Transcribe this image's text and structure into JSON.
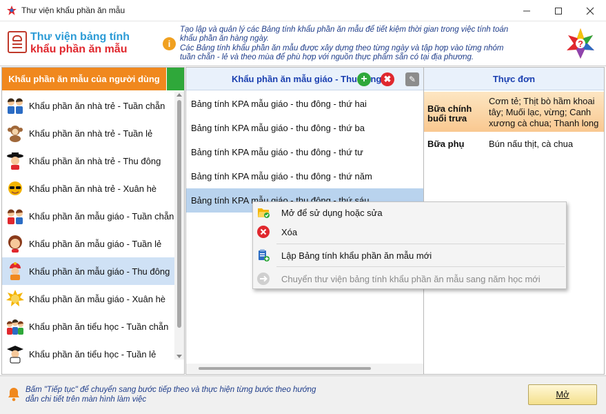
{
  "window": {
    "title": "Thư viện khẩu phần ăn mẫu"
  },
  "header": {
    "brand_line1": "Thư viện bảng tính",
    "brand_line2": "khẩu phần ăn mẫu",
    "desc_line1": "Tạo lập và quản lý các Bảng tính khẩu phần ăn mẫu để tiết kiệm thời gian trong việc tính toán",
    "desc_line2": "khẩu phần ăn hàng ngày.",
    "desc_line3": "Các Bảng tính khẩu phần ăn mẫu được xây dựng theo từng ngày và tập hợp vào từng nhóm",
    "desc_line4": "tuần chẵn - lẻ và theo mùa để phù hợp với nguồn thực phẩm sẵn có tại địa phương."
  },
  "left_panel": {
    "title": "Khẩu phần ăn mẫu của người dùng",
    "items": [
      {
        "label": "Khẩu phần ăn nhà trẻ - Tuần chẵn",
        "icon": "two-kids-icon"
      },
      {
        "label": "Khẩu phần ăn nhà trẻ - Tuần lẻ",
        "icon": "monkey-icon"
      },
      {
        "label": "Khẩu phần ăn nhà trẻ - Thu đông",
        "icon": "kid-hat-icon"
      },
      {
        "label": "Khẩu phần ăn nhà trẻ - Xuân hè",
        "icon": "sun-glasses-icon"
      },
      {
        "label": "Khẩu phần ăn mẫu giáo - Tuần chẵn",
        "icon": "two-kids-icon"
      },
      {
        "label": "Khẩu phần ăn mẫu giáo - Tuần lẻ",
        "icon": "girl-icon"
      },
      {
        "label": "Khẩu phần ăn mẫu giáo - Thu đông",
        "icon": "kid-winter-icon"
      },
      {
        "label": "Khẩu phần ăn mẫu giáo - Xuân hè",
        "icon": "sun-icon"
      },
      {
        "label": "Khẩu phần ăn tiểu học - Tuần chẵn",
        "icon": "three-kids-icon"
      },
      {
        "label": "Khẩu phần ăn tiểu học - Tuần lẻ",
        "icon": "student-icon"
      }
    ],
    "selected_index": 6
  },
  "mid_panel": {
    "title": "Khẩu phần ăn mẫu giáo - Thu đông",
    "items": [
      "Bảng tính KPA mẫu giáo -  thu đông - thứ hai",
      "Bảng tính KPA mẫu giáo -  thu đông - thứ ba",
      "Bảng tính KPA mẫu giáo -  thu đông - thứ tư",
      "Bảng tính KPA mẫu giáo -  thu đông - thứ năm",
      "Bảng tính KPA mẫu giáo -  thu đông - thứ sáu"
    ],
    "selected_index": 4
  },
  "right_panel": {
    "title": "Thực đơn",
    "main_meal_line1": "Bữa chính",
    "main_meal_line2": "buổi trưa",
    "main_food": "Cơm tẻ; Thịt bò hầm khoai tây; Muối lạc, vừng; Canh xương cà chua; Thanh long",
    "side_meal": "Bữa phụ",
    "side_food": "Bún nấu thịt, cà chua"
  },
  "context_menu": {
    "open_edit": "Mở để sử dụng hoặc sửa",
    "delete": "Xóa",
    "new_sheet": "Lập Bảng tính khẩu phần ăn mẫu mới",
    "move_library": "Chuyển thư viện bảng tính khẩu phần ăn mẫu sang năm học mới"
  },
  "footer": {
    "hint_line1": "Bấm \"Tiếp tục\" để chuyển sang bước tiếp theo và thực hiện từng bước theo hướng",
    "hint_line2": "dẫn chi tiết trên màn hình làm việc",
    "open_button": "Mở"
  },
  "colors": {
    "accent_orange": "#f0881e",
    "accent_green": "#2fa83a",
    "brand_red": "#e0282e",
    "selection_blue": "#cfe1f5",
    "header_blue": "#1a3fb0"
  }
}
